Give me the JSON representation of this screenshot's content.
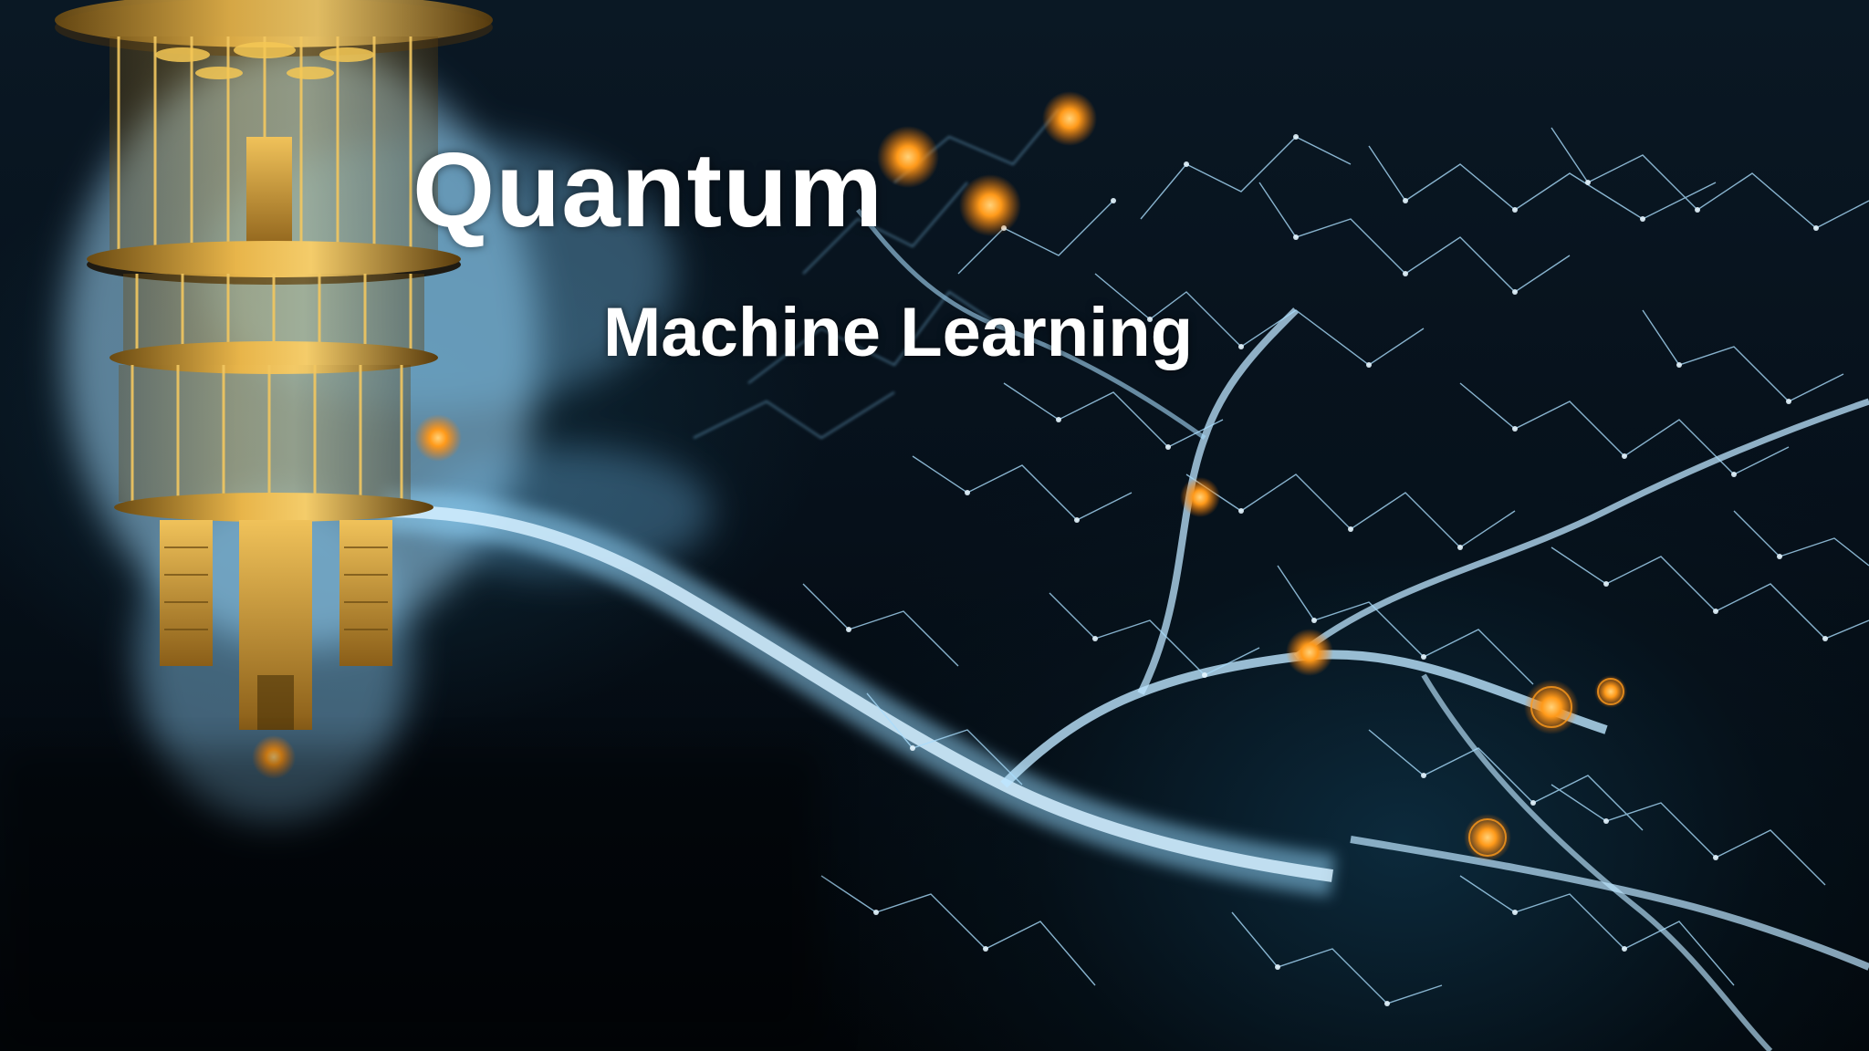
{
  "image": {
    "title": "Quantum",
    "subtitle": "Machine Learning",
    "palette": {
      "background": "#06101a",
      "neuron": "#bfe6ff",
      "neuron_glow": "#4aa8e0",
      "node_orange": "#ff9a1a",
      "gold": "#d4a03a"
    },
    "icons": [
      "quantum-computer-chandelier-icon",
      "neural-network-icon"
    ]
  }
}
